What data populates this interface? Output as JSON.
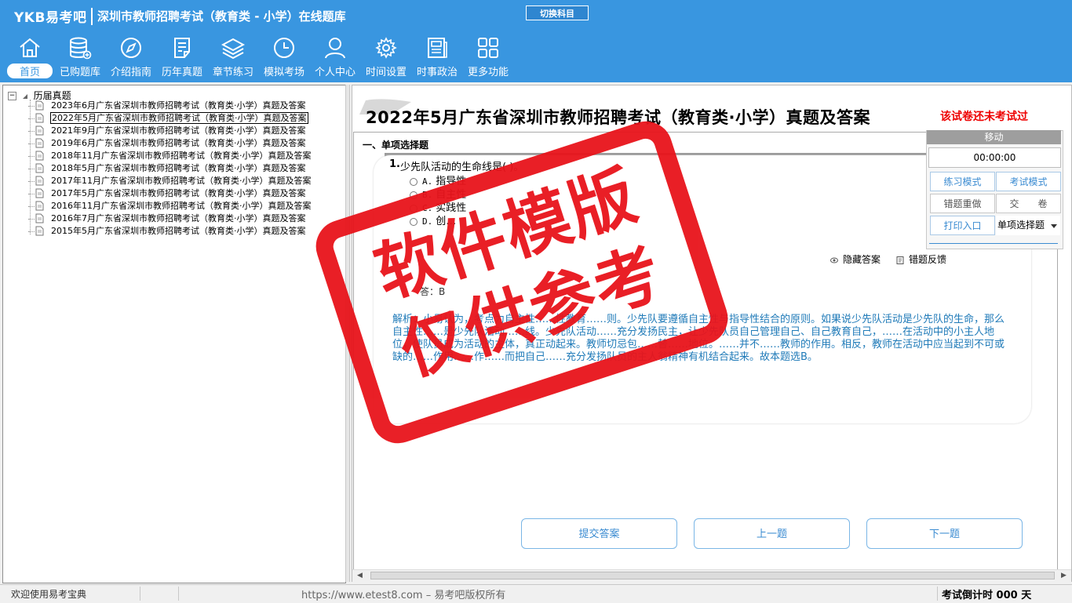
{
  "header": {
    "brand": "YKB易考吧",
    "app_title": "深圳市教师招聘考试（教育类 - 小学）在线题库",
    "switch_subject": "切换科目",
    "nav": [
      {
        "label": "首页",
        "icon": "home-icon",
        "active": true
      },
      {
        "label": "已购题库",
        "icon": "database-icon"
      },
      {
        "label": "介绍指南",
        "icon": "compass-icon"
      },
      {
        "label": "历年真题",
        "icon": "document-list-icon"
      },
      {
        "label": "章节练习",
        "icon": "layers-icon"
      },
      {
        "label": "模拟考场",
        "icon": "clock-icon"
      },
      {
        "label": "个人中心",
        "icon": "user-icon"
      },
      {
        "label": "时间设置",
        "icon": "gear-icon"
      },
      {
        "label": "时事政治",
        "icon": "newspaper-icon"
      },
      {
        "label": "更多功能",
        "icon": "grid-icon"
      }
    ]
  },
  "tree": {
    "root": "历届真题",
    "items": [
      "2023年6月广东省深圳市教师招聘考试（教育类·小学）真题及答案",
      "2022年5月广东省深圳市教师招聘考试（教育类·小学）真题及答案",
      "2021年9月广东省深圳市教师招聘考试（教育类·小学）真题及答案",
      "2019年6月广东省深圳市教师招聘考试（教育类·小学）真题及答案",
      "2018年11月广东省深圳市教师招聘考试（教育类·小学）真题及答案",
      "2018年5月广东省深圳市教师招聘考试（教育类·小学）真题及答案",
      "2017年11月广东省深圳市教师招聘考试（教育类·小学）真题及答案",
      "2017年5月广东省深圳市教师招聘考试（教育类·小学）真题及答案",
      "2016年11月广东省深圳市教师招聘考试（教育类·小学）真题及答案",
      "2016年7月广东省深圳市教师招聘考试（教育类·小学）真题及答案",
      "2015年5月广东省深圳市教师招聘考试（教育类·小学）真题及答案"
    ],
    "selected_index": 1
  },
  "paper": {
    "title": "2022年5月广东省深圳市教师招聘考试（教育类·小学）真题及答案",
    "status": "该试卷还未考试过",
    "section": "一、单项选择题",
    "question": {
      "number": "1.",
      "text": "少先队活动的生命线是(    )。",
      "options": [
        {
          "letter": "A.",
          "text": "指导性"
        },
        {
          "letter": "B.",
          "text": "自主性"
        },
        {
          "letter": "C.",
          "text": "实践性"
        },
        {
          "letter": "D.",
          "text": "创…"
        }
      ],
      "answer_line": "答：B",
      "analysis": "解析：小易认为，考点为自主性……性教育……则。少先队要遵循自主性与指导性结合的原则。如果说少先队活动是少先队的生命，那么自主性……是少先队活动……线。少先队活动……充分发扬民主，让少先队员自己管理自己、自己教育自己，……在活动中的小主人地位，使队员成为活动的主体，真正动起来。教师切忌包……替……地位。……并不……教师的作用。相反，教师在活动中应当起到不可或缺的……作用……作……而把自己……充分发扬队员的主人翁精神有机结合起来。故本题选B。"
    },
    "hide_answer": "隐藏答案",
    "report_error": "错题反馈"
  },
  "control": {
    "move": "移动",
    "timer": "00:00:00",
    "practice_mode": "练习模式",
    "exam_mode": "考试模式",
    "redo_wrong": "错题重做",
    "submit_paper": "交　　卷",
    "print": "打印入口",
    "question_type": "单项选择题"
  },
  "buttons": {
    "submit_answer": "提交答案",
    "prev": "上一题",
    "next": "下一题"
  },
  "statusbar": {
    "welcome": "欢迎使用易考宝典",
    "url": "https://www.etest8.com – 易考吧版权所有",
    "countdown": "考试倒计时 000 天"
  },
  "watermark": {
    "line1": "软件模版",
    "line2": "仅供参考"
  },
  "colors": {
    "header_bg": "#3996e0",
    "accent_blue": "#3a8bd1",
    "analysis_text": "#1f7ab8",
    "status_red": "#e00000",
    "stamp_red": "#e8141b"
  }
}
